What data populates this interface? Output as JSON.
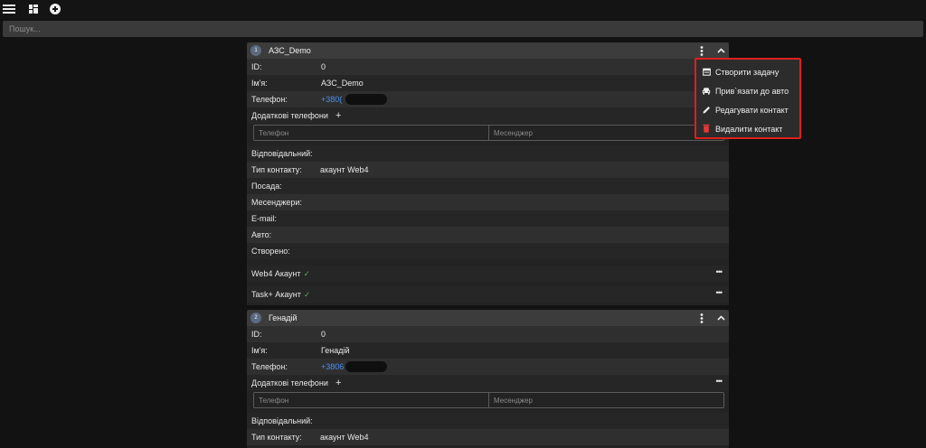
{
  "topbar": {
    "icons": [
      "menu-icon",
      "dashboard-icon",
      "add-circle-icon"
    ]
  },
  "search": {
    "placeholder": "Пошук..."
  },
  "contacts": [
    {
      "index": "1",
      "title": "АЗС_Demo",
      "fields": {
        "id_label": "ID:",
        "id_value": "0",
        "name_label": "Ім'я:",
        "name_value": "АЗС_Demo",
        "phone_label": "Телефон:",
        "phone_value": "+380(",
        "extra_phones_label": "Додаткові телефони",
        "phone_placeholder": "Телефон",
        "messenger_placeholder": "Месенджер",
        "responsible_label": "Відповідальний:",
        "contact_type_label": "Тип контакту:",
        "contact_type_value": "акаунт Web4",
        "position_label": "Посада:",
        "messengers_label": "Месенджери:",
        "email_label": "E-mail:",
        "auto_label": "Авто:",
        "created_label": "Створено:",
        "web4_account_label": "Web4 Акаунт",
        "taskplus_account_label": "Task+ Акаунт"
      }
    },
    {
      "index": "2",
      "title": "Генадій",
      "fields": {
        "id_label": "ID:",
        "id_value": "0",
        "name_label": "Ім'я:",
        "name_value": "Генадій",
        "phone_label": "Телефон:",
        "phone_value": "+3806",
        "extra_phones_label": "Додаткові телефони",
        "phone_placeholder": "Телефон",
        "messenger_placeholder": "Месенджер",
        "responsible_label": "Відповідальний:",
        "contact_type_label": "Тип контакту:",
        "contact_type_value": "акаунт Web4"
      }
    }
  ],
  "context_menu": {
    "highlight_color": "#e01e1e",
    "items": [
      {
        "label": "Створити задачу",
        "icon": "calendar-icon"
      },
      {
        "label": "Прив`язати до авто",
        "icon": "car-icon"
      },
      {
        "label": "Редагувати контакт",
        "icon": "pencil-icon"
      },
      {
        "label": "Видалити контакт",
        "icon": "trash-icon"
      }
    ]
  },
  "colors": {
    "accent_link": "#4c8ff0",
    "check": "#4caf50",
    "delete": "#e53935"
  }
}
